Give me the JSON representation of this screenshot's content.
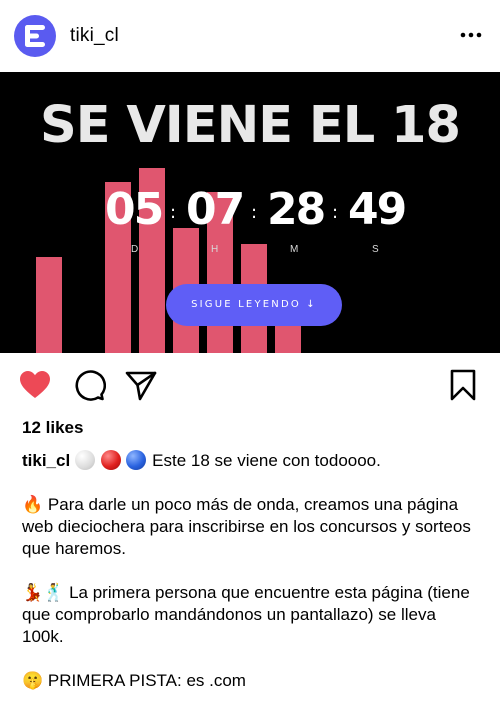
{
  "header": {
    "username": "tiki_cl",
    "avatar_icon": "tiki-logo-icon",
    "more_icon": "more-horizontal-icon"
  },
  "post_image": {
    "headline": "SE VIENE EL 18",
    "countdown": [
      {
        "value": "05",
        "unit": "D"
      },
      {
        "value": "07",
        "unit": "H"
      },
      {
        "value": "28",
        "unit": "M"
      },
      {
        "value": "49",
        "unit": "S"
      }
    ],
    "separator": ":",
    "cta_label": "SIGUE LEYENDO ↓",
    "bar_color": "#e0566f",
    "cta_color": "#5f5ef6"
  },
  "actions": {
    "like_icon": "heart-filled-icon",
    "comment_icon": "comment-icon",
    "share_icon": "send-icon",
    "save_icon": "bookmark-icon",
    "like_color": "#ed4956"
  },
  "likes": "12 likes",
  "caption": {
    "user": "tiki_cl",
    "line1_text": "Este 18 se viene con todoooo.",
    "para2_emoji": "🔥",
    "para2_text": "Para darle un poco más de onda, creamos una página web dieciochera para inscribirse en los concursos y sorteos que haremos.",
    "para3_emoji": "💃🕺",
    "para3_text": "La primera persona que encuentre esta página (tiene que comprobarlo mandándonos un pantallazo) se lleva 100k.",
    "para4_emoji": "🤫",
    "para4_text": "PRIMERA PISTA: es .com"
  }
}
